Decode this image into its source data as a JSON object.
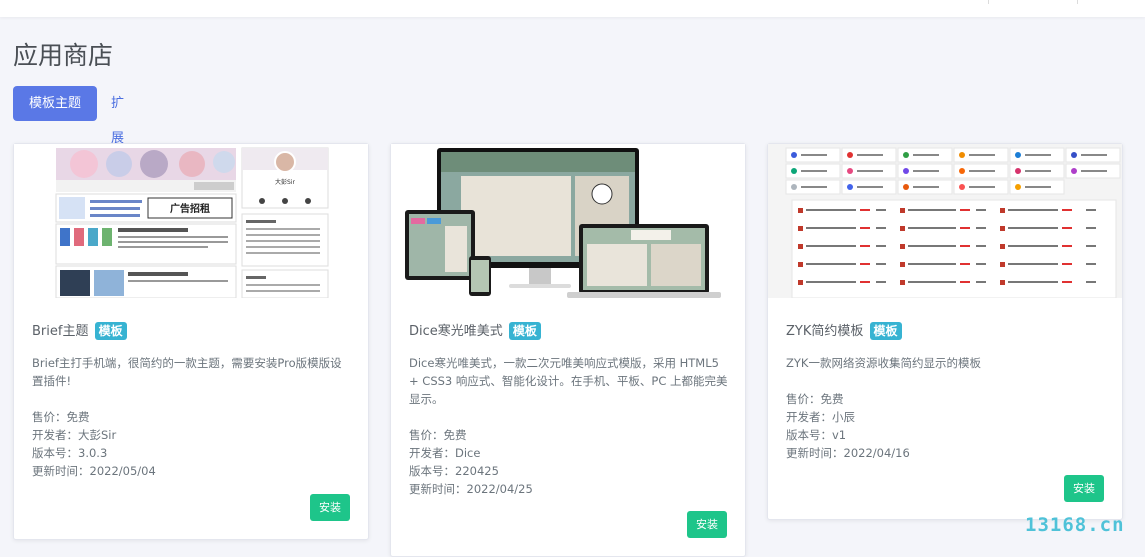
{
  "page": {
    "title": "应用商店"
  },
  "tabs": [
    {
      "label": "模板主题",
      "active": true
    },
    {
      "label": "扩展插件",
      "active": false
    }
  ],
  "cards": [
    {
      "title": "Brief主题",
      "badge": "模板",
      "description": "Brief主打手机端，很简约的一款主题，需要安装Pro版模版设置插件!",
      "price": "售价：免费",
      "developer": "开发者：大彭Sir",
      "version": "版本号：3.0.3",
      "updated": "更新时间：2022/05/04",
      "install_label": "安装",
      "thumb_texts": [
        "广告招租",
        "大彭Sir",
        "Emlog小程序"
      ]
    },
    {
      "title": "Dice寒光唯美式",
      "badge": "模板",
      "description": "Dice寒光唯美式，一款二次元唯美响应式模版，采用 HTML5 + CSS3 响应式、智能化设计。在手机、平板、PC 上都能完美显示。",
      "price": "售价：免费",
      "developer": "开发者：Dice",
      "version": "版本号：220425",
      "updated": "更新时间：2022/04/25",
      "install_label": "安装"
    },
    {
      "title": "ZYK简约模板",
      "badge": "模板",
      "description": "ZYK一款网络资源收集简约显示的模板",
      "price": "售价：免费",
      "developer": "开发者：小辰",
      "version": "版本号：v1",
      "updated": "更新时间：2022/04/16",
      "install_label": "安装"
    }
  ],
  "watermark": "13168.cn",
  "colors": {
    "primary": "#5a78e6",
    "badge": "#37b3d2",
    "install": "#1ec58a"
  }
}
